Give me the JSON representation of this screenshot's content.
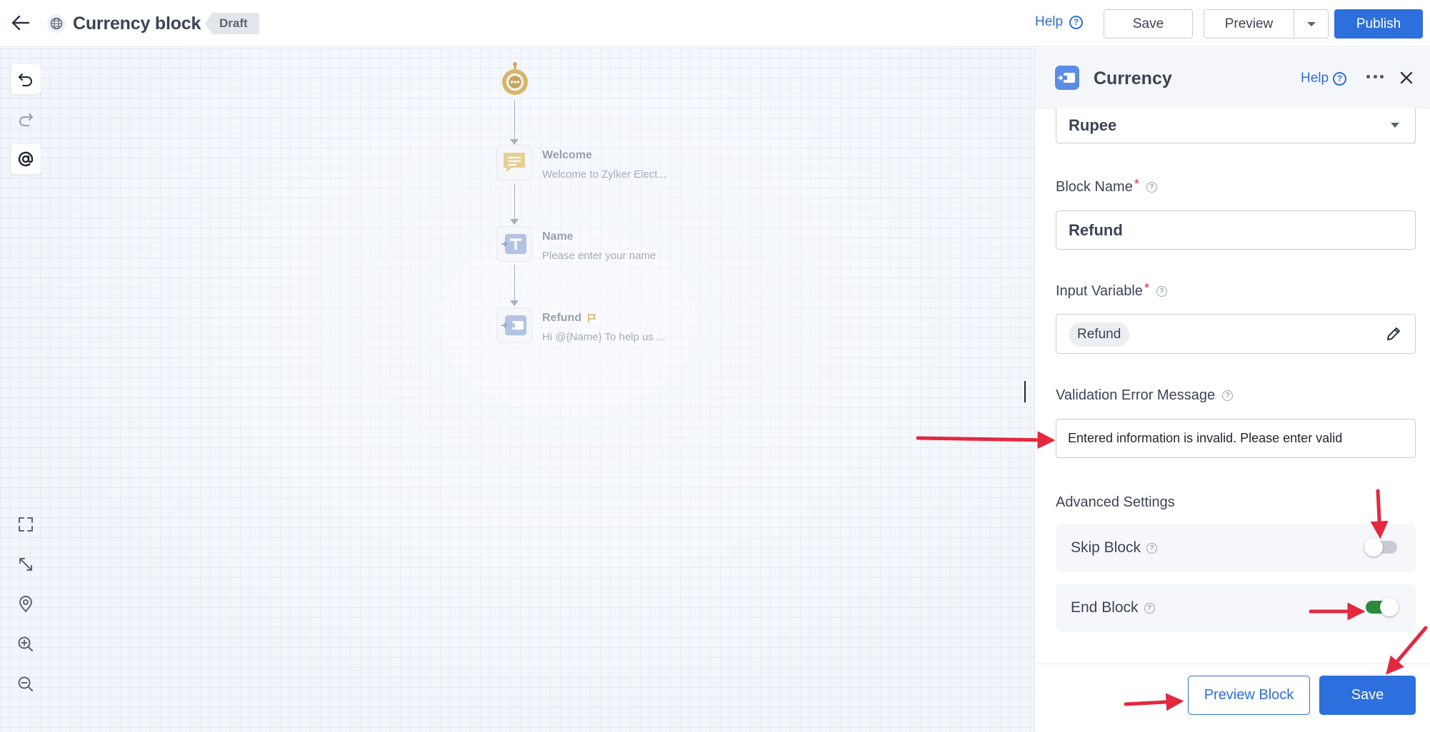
{
  "topbar": {
    "title": "Currency block",
    "status_badge": "Draft",
    "help_label": "Help",
    "save_label": "Save",
    "preview_label": "Preview",
    "publish_label": "Publish"
  },
  "canvas": {
    "tools": [
      "undo-icon",
      "redo-icon",
      "mention-icon",
      "fullscreen-icon",
      "fit-screen-icon",
      "locate-icon",
      "zoom-in-icon",
      "zoom-out-icon"
    ],
    "nodes": [
      {
        "title": "Welcome",
        "subtitle": "Welcome to Zylker Elect..."
      },
      {
        "title": "Name",
        "subtitle": "Please enter your name"
      },
      {
        "title": "Refund",
        "subtitle": "Hi  @{Name}  To help us ..."
      }
    ]
  },
  "panel": {
    "title": "Currency",
    "help_label": "Help",
    "currency_value": "Rupee",
    "block_name_label": "Block Name",
    "block_name_value": "Refund",
    "input_variable_label": "Input Variable",
    "input_variable_value": "Refund",
    "validation_label": "Validation Error Message",
    "validation_value": "Entered information is invalid. Please enter valid",
    "advanced_title": "Advanced Settings",
    "skip_block_label": "Skip Block",
    "skip_block_enabled": false,
    "end_block_label": "End Block",
    "end_block_enabled": true,
    "preview_block_label": "Preview Block",
    "save_label": "Save"
  },
  "colors": {
    "primary": "#2d6fdc",
    "toggle_on": "#2b8a3e",
    "annotation_arrow": "#e3283f",
    "required": "#e0283b"
  }
}
